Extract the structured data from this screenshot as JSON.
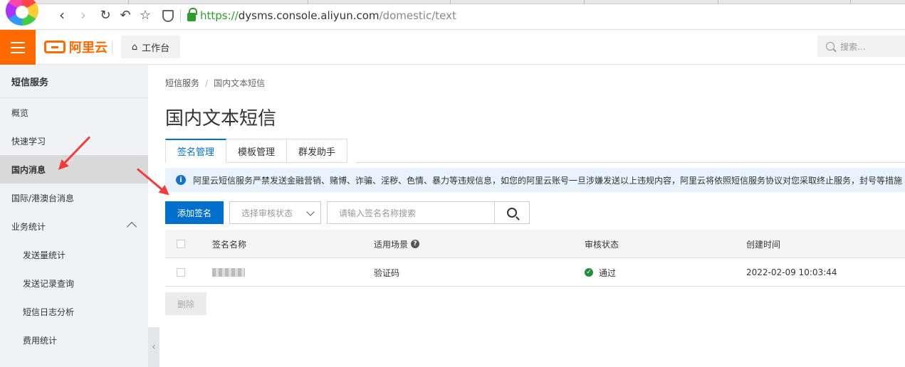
{
  "browser": {
    "url_scheme": "https://",
    "url_host": "dysms.console.aliyun.com",
    "url_path": "/domestic/text"
  },
  "topbar": {
    "brand": "阿里云",
    "workbench": "工作台",
    "search_placeholder": "搜索..."
  },
  "sidebar": {
    "header": "短信服务",
    "items": [
      {
        "label": "概览"
      },
      {
        "label": "快速学习"
      },
      {
        "label": "国内消息"
      },
      {
        "label": "国际/港澳台消息"
      },
      {
        "label": "业务统计"
      },
      {
        "label": "发送量统计"
      },
      {
        "label": "发送记录查询"
      },
      {
        "label": "短信日志分析"
      },
      {
        "label": "费用统计"
      }
    ]
  },
  "main": {
    "breadcrumb": [
      "短信服务",
      "国内文本短信"
    ],
    "title": "国内文本短信",
    "tabs": [
      {
        "label": "签名管理"
      },
      {
        "label": "模板管理"
      },
      {
        "label": "群发助手"
      }
    ],
    "alert": "阿里云短信服务严禁发送金融营销、赌博、诈骗、淫秽、色情、暴力等违规信息，如您的阿里云账号一旦涉嫌发送以上违规内容，阿里云将依照短信服务协议对您采取终止服务，封号等措施",
    "add_button": "添加签名",
    "status_select": "选择审核状态",
    "search_placeholder": "请输入签名名称搜索",
    "delete_button": "删除"
  },
  "table": {
    "headers": [
      "签名名称",
      "适用场景",
      "审核状态",
      "创建时间"
    ],
    "rows": [
      {
        "scene": "验证码",
        "status": "通过",
        "created": "2022-02-09 10:03:44"
      }
    ]
  },
  "colors": {
    "accent": "#0070cc",
    "brand": "#ff6a00",
    "annotation_arrow": "#f23b3b"
  }
}
